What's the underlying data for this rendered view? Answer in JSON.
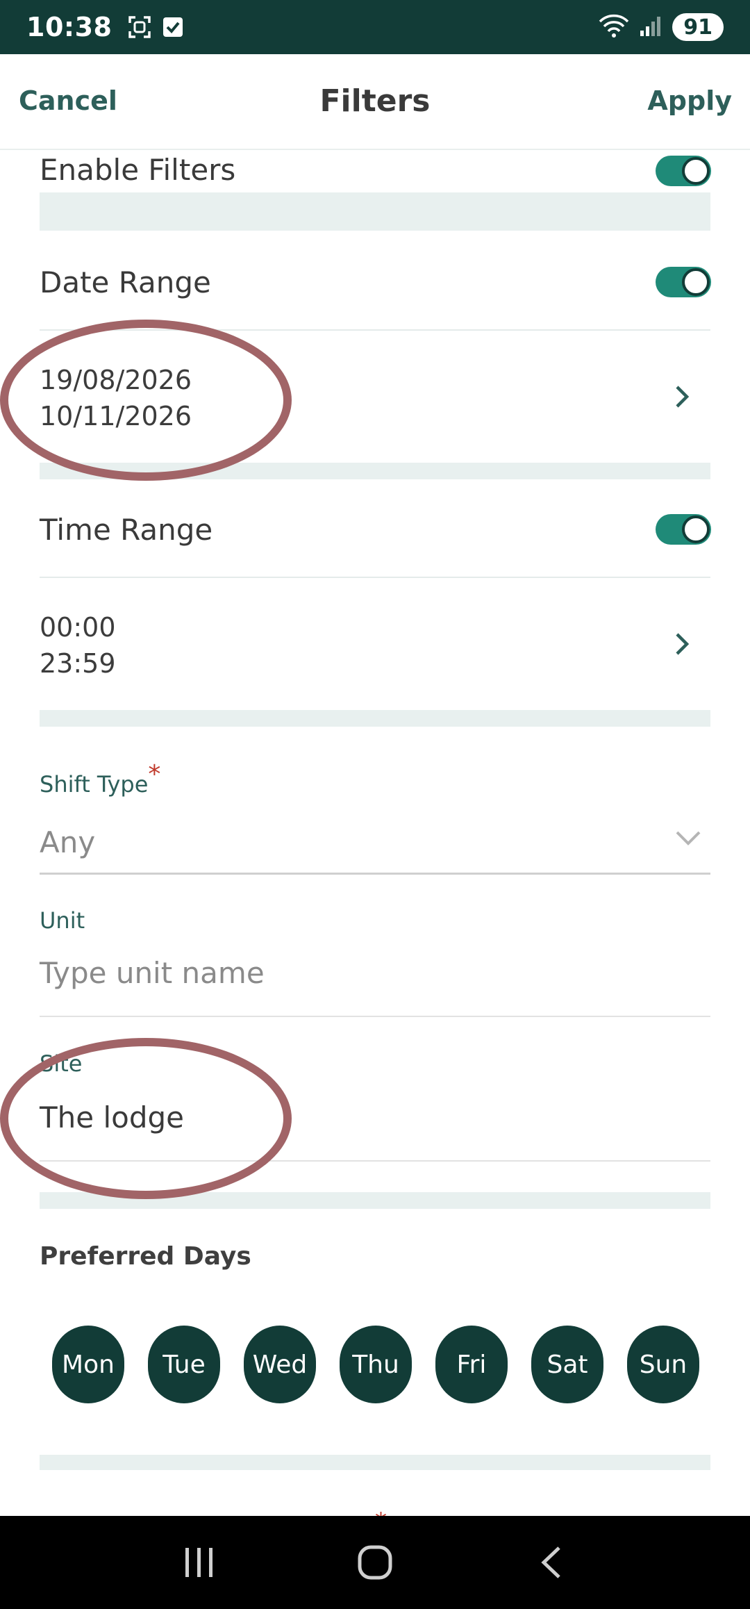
{
  "status": {
    "time": "10:38",
    "battery": "91",
    "icons": [
      "screenshot-icon",
      "checkbox-icon",
      "wifi-icon",
      "signal-icon"
    ]
  },
  "header": {
    "cancel": "Cancel",
    "title": "Filters",
    "apply": "Apply"
  },
  "enable_filters": {
    "label": "Enable Filters",
    "on": true
  },
  "date_range": {
    "label": "Date Range",
    "on": true,
    "start": "19/08/2026",
    "end": "10/11/2026"
  },
  "time_range": {
    "label": "Time Range",
    "on": true,
    "start": "00:00",
    "end": "23:59"
  },
  "shift_type": {
    "label": "Shift Type",
    "required_mark": "*",
    "value": "Any"
  },
  "unit": {
    "label": "Unit",
    "placeholder": "Type unit name"
  },
  "site": {
    "label": "Site",
    "value": "The lodge"
  },
  "preferred_days": {
    "title": "Preferred Days",
    "days": [
      "Mon",
      "Tue",
      "Wed",
      "Thu",
      "Fri",
      "Sat",
      "Sun"
    ]
  },
  "next_required_mark": "*",
  "colors": {
    "status_bar": "#123c37",
    "accent": "#1f8a78",
    "day_chip": "#123c37",
    "annotation": "#a16467"
  }
}
